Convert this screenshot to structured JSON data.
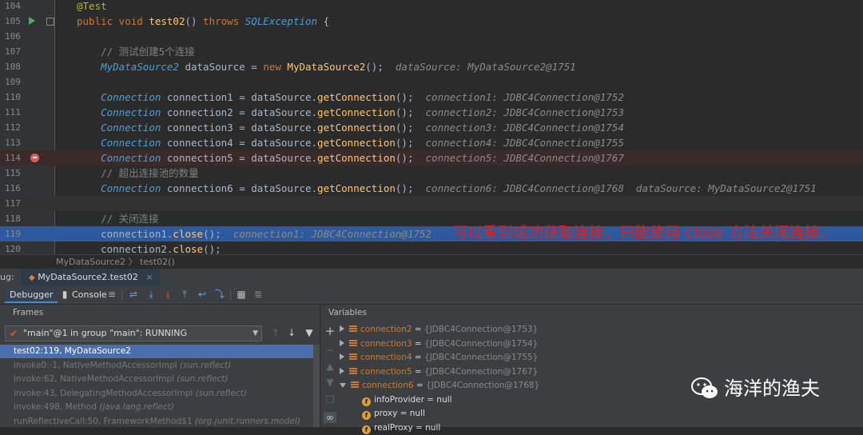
{
  "editor": {
    "lines": [
      {
        "n": "104",
        "html": "<span class='ann'>@Test</span>"
      },
      {
        "n": "105",
        "html": "<span class='kw'>public void </span><span class='cls'>test02</span>() <span class='kw'>throws </span><span class='typ'>SQLException</span> {"
      },
      {
        "n": "106",
        "html": ""
      },
      {
        "n": "107",
        "html": "    <span class='cm'>// 测试创建5个连接</span>"
      },
      {
        "n": "108",
        "html": "    <span class='typ'>MyDataSource2</span> dataSource = <span class='kw'>new </span><span class='mth'>MyDataSource2</span>();  <span class='hint'>dataSource: MyDataSource2@1751</span>"
      },
      {
        "n": "109",
        "html": ""
      },
      {
        "n": "110",
        "html": "    <span class='typ'>Connection</span> connection1 = dataSource.<span class='mth'>getConnection</span>();  <span class='hint'>connection1: JDBC4Connection@1752</span>"
      },
      {
        "n": "111",
        "html": "    <span class='typ'>Connection</span> connection2 = dataSource.<span class='mth'>getConnection</span>();  <span class='hint'>connection2: JDBC4Connection@1753</span>"
      },
      {
        "n": "112",
        "html": "    <span class='typ'>Connection</span> connection3 = dataSource.<span class='mth'>getConnection</span>();  <span class='hint'>connection3: JDBC4Connection@1754</span>"
      },
      {
        "n": "113",
        "html": "    <span class='typ'>Connection</span> connection4 = dataSource.<span class='mth'>getConnection</span>();  <span class='hint'>connection4: JDBC4Connection@1755</span>"
      },
      {
        "n": "114",
        "html": "    <span class='typ'>Connection</span> connection5 = dataSource.<span class='mth'>getConnection</span>();  <span class='hint'>connection5: JDBC4Connection@1767</span>"
      },
      {
        "n": "115",
        "html": "    <span class='cm'>// 超出连接池的数量</span>"
      },
      {
        "n": "116",
        "html": "    <span class='typ'>Connection</span> connection6 = dataSource.<span class='mth'>getConnection</span>();  <span class='hint'>connection6: JDBC4Connection@1768  dataSource: MyDataSource2@1751</span>"
      },
      {
        "n": "117",
        "html": ""
      },
      {
        "n": "118",
        "html": "    <span class='cm'>// 关闭连接</span>"
      },
      {
        "n": "119",
        "html": "    connection1.<span class='mth'>close</span>();  <span class='hint'>connection1: JDBC4Connection@1752</span>"
      },
      {
        "n": "120",
        "html": "    connection2.<span class='mth'>close</span>();"
      }
    ],
    "annotation_note": "可以看到成功获取连接，只能使用 close 方法关闭连接。",
    "breadcrumb": "MyDataSource2 〉 test02()"
  },
  "debug": {
    "label": "ug:",
    "session_tab": "MyDataSource2.test02",
    "tabs": {
      "debugger": "Debugger",
      "console": "Console"
    },
    "frames_title": "Frames",
    "variables_title": "Variables",
    "thread": "\"main\"@1 in group \"main\": RUNNING",
    "frames": [
      {
        "text": "test02:119, MyDataSource2",
        "pkg": ""
      },
      {
        "text": "invoke0:-1, NativeMethodAccessorImpl ",
        "pkg": "(sun.reflect)"
      },
      {
        "text": "invoke:62, NativeMethodAccessorImpl ",
        "pkg": "(sun.reflect)"
      },
      {
        "text": "invoke:43, DelegatingMethodAccessorImpl ",
        "pkg": "(sun.reflect)"
      },
      {
        "text": "invoke:498, Method ",
        "pkg": "(java.lang.reflect)"
      },
      {
        "text": "runReflectiveCall:50, FrameworkMethod$1 ",
        "pkg": "(org.junit.runners.model)"
      }
    ],
    "variables": [
      {
        "name": "connection2",
        "value": "{JDBC4Connection@1753}",
        "kind": "local",
        "expanded": false,
        "indent": 0
      },
      {
        "name": "connection3",
        "value": "{JDBC4Connection@1754}",
        "kind": "local",
        "expanded": false,
        "indent": 0
      },
      {
        "name": "connection4",
        "value": "{JDBC4Connection@1755}",
        "kind": "local",
        "expanded": false,
        "indent": 0
      },
      {
        "name": "connection5",
        "value": "{JDBC4Connection@1767}",
        "kind": "local",
        "expanded": false,
        "indent": 0
      },
      {
        "name": "connection6",
        "value": "{JDBC4Connection@1768}",
        "kind": "local",
        "expanded": true,
        "indent": 0
      },
      {
        "name": "infoProvider",
        "value": "null",
        "kind": "field",
        "expanded": null,
        "indent": 1
      },
      {
        "name": "proxy",
        "value": "null",
        "kind": "field",
        "expanded": null,
        "indent": 1
      },
      {
        "name": "realProxy",
        "value": "null",
        "kind": "field",
        "expanded": null,
        "indent": 1
      }
    ]
  },
  "watermark": "海洋的渔夫"
}
